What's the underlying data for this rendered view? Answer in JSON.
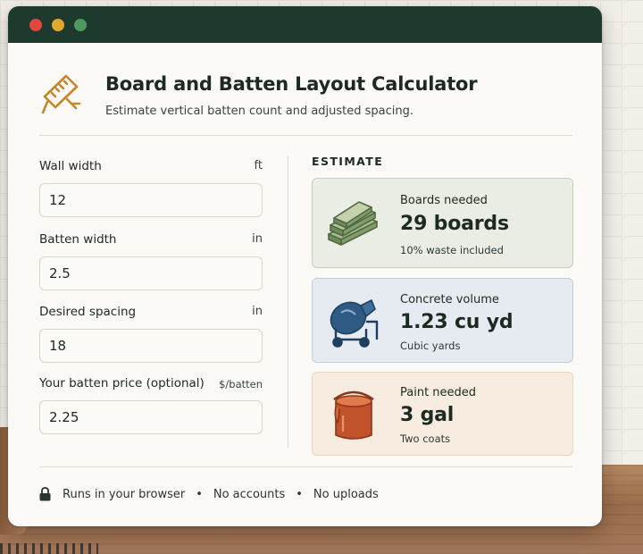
{
  "window": {
    "controls": [
      "close",
      "minimize",
      "maximize"
    ]
  },
  "header": {
    "title": "Board and Batten Layout Calculator",
    "subtitle": "Estimate vertical batten count and adjusted spacing.",
    "icon": "ruler-icon"
  },
  "form": {
    "fields": [
      {
        "label": "Wall width",
        "unit": "ft",
        "value": "12"
      },
      {
        "label": "Batten width",
        "unit": "in",
        "value": "2.5"
      },
      {
        "label": "Desired spacing",
        "unit": "in",
        "value": "18"
      },
      {
        "label": "Your batten price (optional)",
        "unit": "$/batten",
        "value": "2.25"
      }
    ]
  },
  "estimate": {
    "heading": "ESTIMATE",
    "cards": [
      {
        "label": "Boards needed",
        "value": "29 boards",
        "note": "10% waste included",
        "icon": "boards-icon",
        "color": "#eaede4"
      },
      {
        "label": "Concrete volume",
        "value": "1.23 cu yd",
        "note": "Cubic yards",
        "icon": "cement-mixer-icon",
        "color": "#e6ebf1"
      },
      {
        "label": "Paint needed",
        "value": "3 gal",
        "note": "Two coats",
        "icon": "paint-can-icon",
        "color": "#f8ece0"
      }
    ]
  },
  "footer": {
    "items": [
      "Runs in your browser",
      "No accounts",
      "No uploads"
    ],
    "icon": "lock-icon"
  },
  "colors": {
    "titlebar": "#1e3a2e",
    "accent_orange": "#c8862a",
    "card_green_icon": "#5c7a4c",
    "card_blue_icon": "#2f5a83",
    "card_peach_icon": "#c0532b"
  }
}
